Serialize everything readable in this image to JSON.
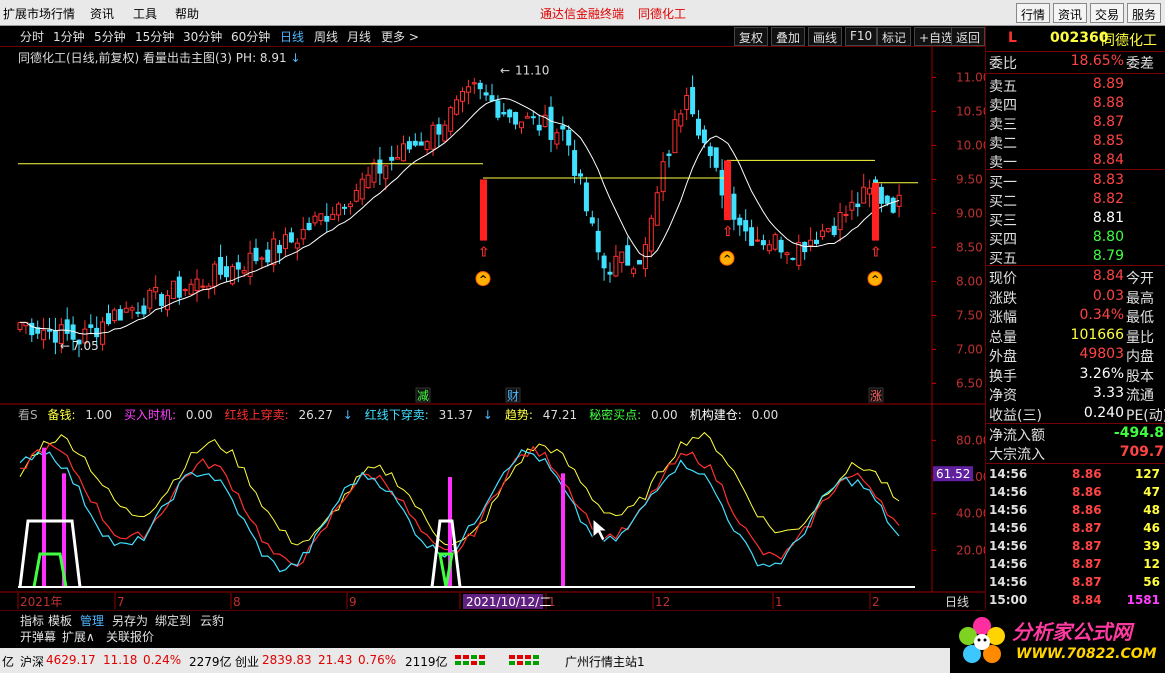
{
  "menubar": {
    "items": [
      "扩展市场行情",
      "资讯",
      "工具",
      "帮助"
    ],
    "center": [
      "通达信金融终端",
      "同德化工"
    ],
    "right_buttons": [
      "行情",
      "资讯",
      "交易",
      "服务"
    ]
  },
  "periods": [
    "分时",
    "1分钟",
    "5分钟",
    "15分钟",
    "30分钟",
    "60分钟",
    "日线",
    "周线",
    "月线",
    "更多 >"
  ],
  "active_period": "日线",
  "tools": [
    "复权",
    "叠加",
    "画线",
    "F10",
    "标记",
    "+自选",
    "返回"
  ],
  "chart": {
    "info": "同德化工(日线,前复权) 看量出击主图(3) PH: 8.91",
    "high_label": "11.10",
    "low_label": "7.05",
    "price_ticks": [
      "11.00",
      "10.50",
      "10.00",
      "9.50",
      "9.00",
      "8.50",
      "8.00",
      "7.50",
      "7.00",
      "6.50"
    ],
    "ind_ticks": [
      "80.00",
      "60.00",
      "40.00",
      "20.00"
    ],
    "ind_current": "61.52",
    "markers": [
      "减",
      "财",
      "涨"
    ],
    "date_axis": [
      "2021年",
      "7",
      "8",
      "9",
      "1",
      "1",
      "12",
      "1",
      "2"
    ],
    "cursor_date": "2021/10/12/二",
    "period_label": "日线",
    "accent_red": "#ff2020",
    "accent_yellow": "#ffff40"
  },
  "indicator": {
    "name_prefix": "看S",
    "items": [
      {
        "label": "备钱:",
        "value": "1.00",
        "color": "#ffff40"
      },
      {
        "label": "买入时机:",
        "value": "0.00",
        "color": "#ff40ff"
      },
      {
        "label": "红线上穿卖:",
        "value": "26.27",
        "color": "#ff3030"
      },
      {
        "label": "红线下穿卖:",
        "value": "31.37",
        "color": "#40e0ff"
      },
      {
        "label": "趋势:",
        "value": "47.21",
        "color": "#ffff40"
      },
      {
        "label": "秘密买点:",
        "value": "0.00",
        "color": "#40ff40"
      },
      {
        "label": "机构建仓:",
        "value": "0.00",
        "color": "#ffffff"
      }
    ]
  },
  "tabs1": [
    "指标",
    "模板",
    "管理",
    "另存为",
    "绑定到",
    "云豹"
  ],
  "tabs2": [
    "开弹幕",
    "扩展∧",
    "关联报价"
  ],
  "status": {
    "sh_label": "沪深",
    "sh_value": "4629.17",
    "sh_change": "11.18",
    "sh_pct": "0.24%",
    "sh_amount": "2279亿",
    "cy_label": "创业",
    "cy_value": "2839.83",
    "cy_change": "21.43",
    "cy_pct": "0.76%",
    "cy_amount": "2119亿",
    "server": "广州行情主站1",
    "prefix": "亿"
  },
  "quote": {
    "flag": "L",
    "code": "002360",
    "name": "同德化工",
    "ratio_label": "委比",
    "ratio": "18.65%",
    "diff_label": "委差",
    "sells": [
      {
        "label": "卖五",
        "price": "8.89"
      },
      {
        "label": "卖四",
        "price": "8.88"
      },
      {
        "label": "卖三",
        "price": "8.87"
      },
      {
        "label": "卖二",
        "price": "8.85"
      },
      {
        "label": "卖一",
        "price": "8.84"
      }
    ],
    "buys": [
      {
        "label": "买一",
        "price": "8.83",
        "color": "#ff4444"
      },
      {
        "label": "买二",
        "price": "8.82",
        "color": "#ff4444"
      },
      {
        "label": "买三",
        "price": "8.81",
        "color": "#ffffff"
      },
      {
        "label": "买四",
        "price": "8.80",
        "color": "#40ff40"
      },
      {
        "label": "买五",
        "price": "8.79",
        "color": "#40ff40"
      }
    ],
    "stats": [
      {
        "label": "现价",
        "value": "8.84",
        "color": "#ff4444",
        "label2": "今开"
      },
      {
        "label": "涨跌",
        "value": "0.03",
        "color": "#ff4444",
        "label2": "最高"
      },
      {
        "label": "涨幅",
        "value": "0.34%",
        "color": "#ff4444",
        "label2": "最低"
      },
      {
        "label": "总量",
        "value": "101666",
        "color": "#ffff40",
        "label2": "量比"
      },
      {
        "label": "外盘",
        "value": "49803",
        "color": "#ff4444",
        "label2": "内盘"
      },
      {
        "label": "换手",
        "value": "3.26%",
        "color": "#ffffff",
        "label2": "股本"
      },
      {
        "label": "净资",
        "value": "3.33",
        "color": "#ffffff",
        "label2": "流通"
      },
      {
        "label": "收益(三)",
        "value": "0.240",
        "color": "#ffffff",
        "label2": "PE(动)"
      }
    ],
    "flows": [
      {
        "label": "净流入额",
        "value": "-494.8",
        "color": "#40ff40"
      },
      {
        "label": "大宗流入",
        "value": "709.7",
        "color": "#ff4444"
      }
    ],
    "ticks": [
      {
        "time": "14:56",
        "price": "8.86",
        "vol": "127"
      },
      {
        "time": "14:56",
        "price": "8.86",
        "vol": "47"
      },
      {
        "time": "14:56",
        "price": "8.86",
        "vol": "48"
      },
      {
        "time": "14:56",
        "price": "8.87",
        "vol": "46"
      },
      {
        "time": "14:56",
        "price": "8.87",
        "vol": "39"
      },
      {
        "time": "14:56",
        "price": "8.87",
        "vol": "12"
      },
      {
        "time": "14:56",
        "price": "8.87",
        "vol": "56"
      },
      {
        "time": "15:00",
        "price": "8.84",
        "vol": "1581"
      }
    ]
  },
  "logo": {
    "text": "分析家公式网",
    "url_text": "WWW.70822.COM"
  }
}
